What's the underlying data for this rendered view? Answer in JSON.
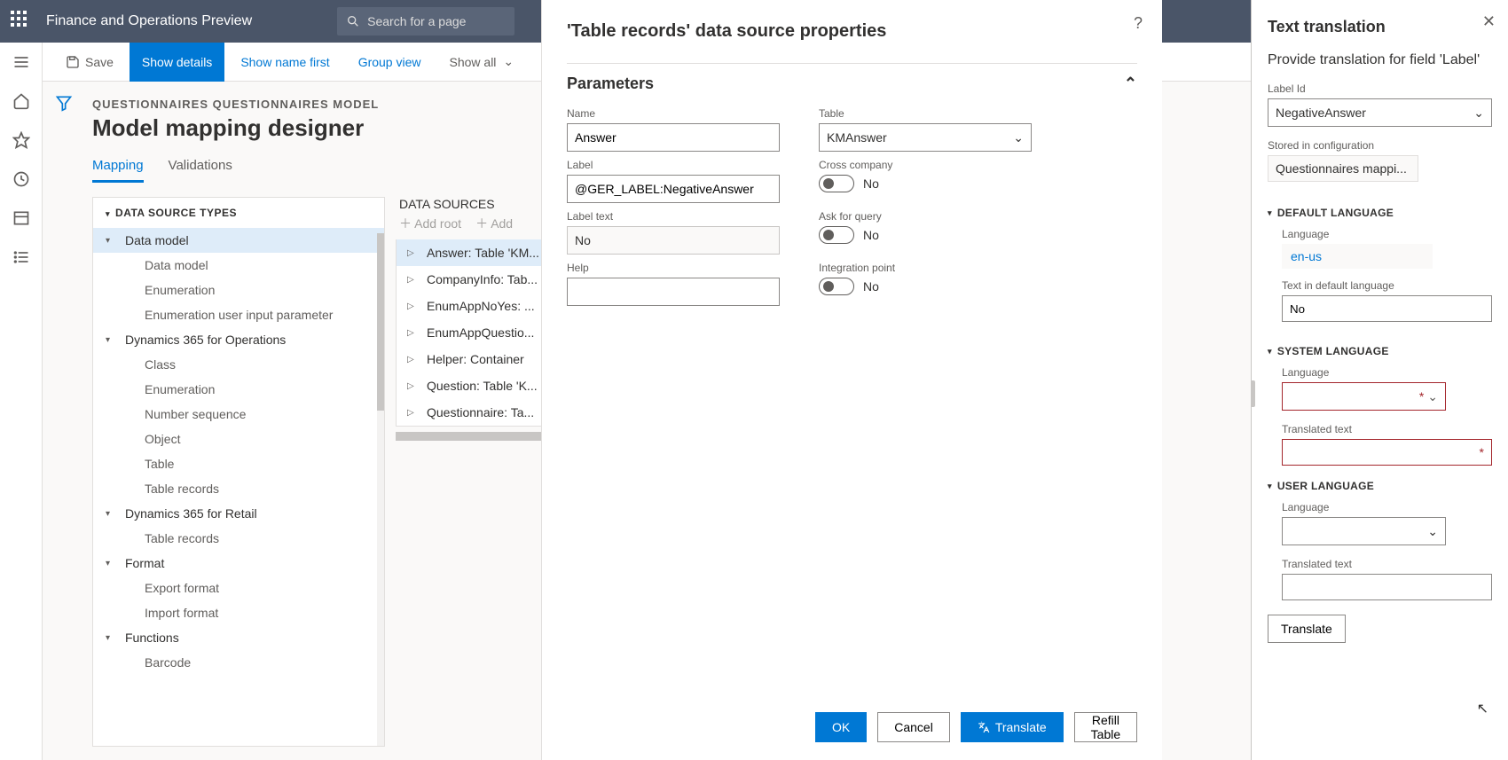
{
  "header": {
    "app_title": "Finance and Operations Preview",
    "search_placeholder": "Search for a page"
  },
  "toolbar": {
    "save": "Save",
    "show_details": "Show details",
    "show_name_first": "Show name first",
    "group_view": "Group view",
    "show_all": "Show all"
  },
  "page": {
    "breadcrumb": "QUESTIONNAIRES QUESTIONNAIRES MODEL",
    "title": "Model mapping designer",
    "tabs": {
      "mapping": "Mapping",
      "validations": "Validations"
    }
  },
  "panel1": {
    "header": "DATA SOURCE TYPES",
    "items": [
      {
        "label": "Data model",
        "type": "group",
        "selected": true
      },
      {
        "label": "Data model",
        "type": "child"
      },
      {
        "label": "Enumeration",
        "type": "child"
      },
      {
        "label": "Enumeration user input parameter",
        "type": "child"
      },
      {
        "label": "Dynamics 365 for Operations",
        "type": "group"
      },
      {
        "label": "Class",
        "type": "child"
      },
      {
        "label": "Enumeration",
        "type": "child"
      },
      {
        "label": "Number sequence",
        "type": "child"
      },
      {
        "label": "Object",
        "type": "child"
      },
      {
        "label": "Table",
        "type": "child"
      },
      {
        "label": "Table records",
        "type": "child"
      },
      {
        "label": "Dynamics 365 for Retail",
        "type": "group"
      },
      {
        "label": "Table records",
        "type": "child"
      },
      {
        "label": "Format",
        "type": "group"
      },
      {
        "label": "Export format",
        "type": "child"
      },
      {
        "label": "Import format",
        "type": "child"
      },
      {
        "label": "Functions",
        "type": "group"
      },
      {
        "label": "Barcode",
        "type": "child"
      }
    ]
  },
  "panel2": {
    "header": "DATA SOURCES",
    "add_root": "Add root",
    "add": "Add",
    "items": [
      {
        "label": "Answer: Table 'KM...",
        "selected": true
      },
      {
        "label": "CompanyInfo: Tab..."
      },
      {
        "label": "EnumAppNoYes: ..."
      },
      {
        "label": "EnumAppQuestio..."
      },
      {
        "label": "Helper: Container"
      },
      {
        "label": "Question: Table 'K..."
      },
      {
        "label": "Questionnaire: Ta..."
      }
    ]
  },
  "dialog": {
    "title": "'Table records' data source properties",
    "section": "Parameters",
    "labels": {
      "name": "Name",
      "label": "Label",
      "label_text": "Label text",
      "help": "Help",
      "table": "Table",
      "cross_company": "Cross company",
      "ask_for_query": "Ask for query",
      "integration_point": "Integration point"
    },
    "values": {
      "name": "Answer",
      "label": "@GER_LABEL:NegativeAnswer",
      "label_text": "No",
      "help": "",
      "table": "KMAnswer",
      "toggle_no": "No"
    },
    "buttons": {
      "ok": "OK",
      "cancel": "Cancel",
      "translate": "Translate",
      "refill": "Refill Table"
    }
  },
  "trans": {
    "title": "Text translation",
    "subtitle": "Provide translation for field 'Label'",
    "label_id_lbl": "Label Id",
    "label_id": "NegativeAnswer",
    "stored_lbl": "Stored in configuration",
    "stored": "Questionnaires mappi...",
    "sections": {
      "default": "DEFAULT LANGUAGE",
      "system": "SYSTEM LANGUAGE",
      "user": "USER LANGUAGE"
    },
    "language_lbl": "Language",
    "default_lang": "en-us",
    "text_default_lbl": "Text in default language",
    "text_default": "No",
    "translated_lbl": "Translated text",
    "translate_btn": "Translate"
  }
}
